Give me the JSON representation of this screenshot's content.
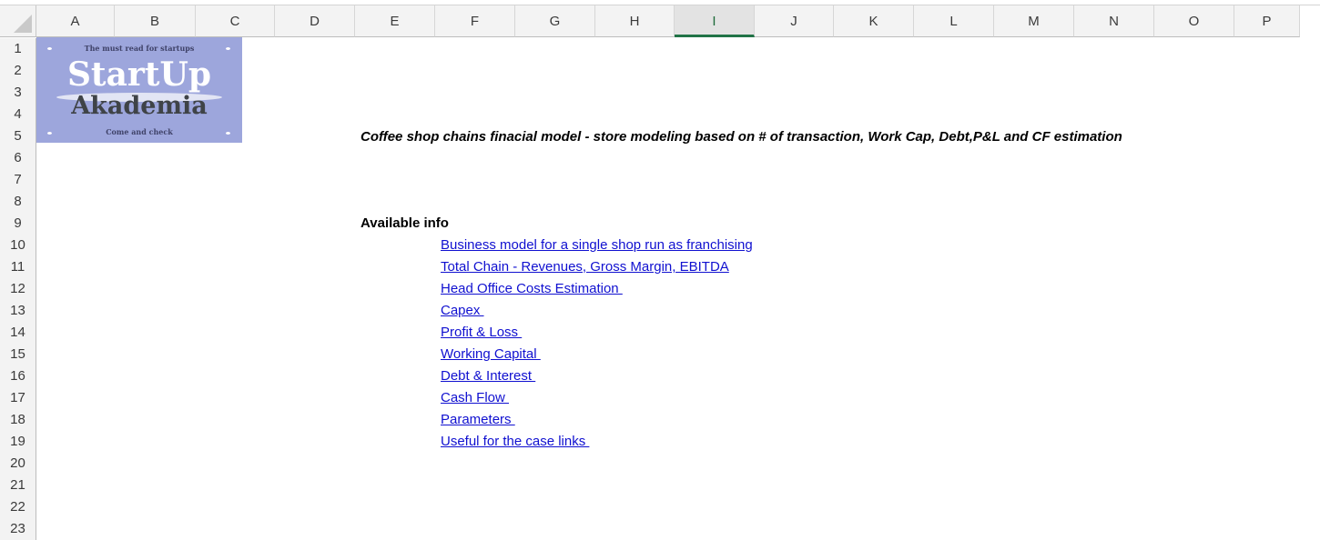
{
  "sheet": {
    "columns": [
      "A",
      "B",
      "C",
      "D",
      "E",
      "F",
      "G",
      "H",
      "I",
      "J",
      "K",
      "L",
      "M",
      "N",
      "O",
      "P"
    ],
    "selected_column": "I",
    "rows": [
      "1",
      "2",
      "3",
      "4",
      "5",
      "6",
      "7",
      "8",
      "9",
      "10",
      "11",
      "12",
      "13",
      "14",
      "15",
      "16",
      "17",
      "18",
      "19",
      "20",
      "21",
      "22",
      "23"
    ]
  },
  "logo": {
    "tagline": "The must read for startups",
    "word1": "StartUp",
    "word2": "Akademia",
    "footer": "Come and  check"
  },
  "content": {
    "title": "Coffee shop chains finacial model - store modeling based on # of transaction, Work Cap, Debt,P&L and CF estimation",
    "section_label": "Available info",
    "links": [
      "Business model for a single shop run as franchising",
      "Total Chain - Revenues, Gross Margin, EBITDA",
      "Head Office Costs Estimation ",
      "Capex ",
      "Profit & Loss ",
      "Working Capital ",
      "Debt & Interest ",
      "Cash Flow ",
      "Parameters ",
      "Useful for the case links "
    ]
  },
  "colors": {
    "link": "#1010d0",
    "logo_bg": "#9da6dc",
    "selection_accent": "#217346"
  }
}
